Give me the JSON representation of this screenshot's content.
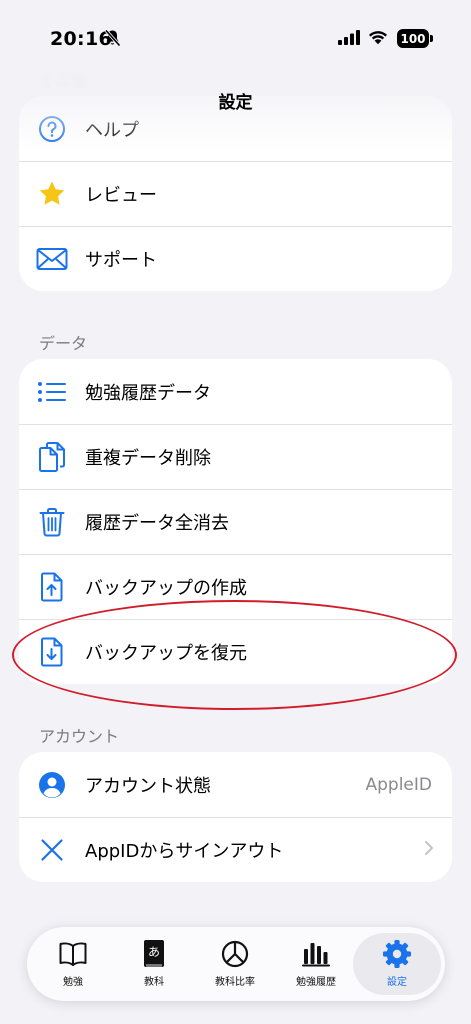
{
  "status_bar": {
    "time": "20:16",
    "battery": "100"
  },
  "nav": {
    "title": "設定",
    "ghost_header": "その他"
  },
  "sections": {
    "other": {
      "items": [
        {
          "label": "ヘルプ",
          "icon": "question-circle-icon"
        },
        {
          "label": "レビュー",
          "icon": "star-icon"
        },
        {
          "label": "サポート",
          "icon": "envelope-icon"
        }
      ]
    },
    "data": {
      "title": "データ",
      "items": [
        {
          "label": "勉強履歴データ",
          "icon": "list-icon"
        },
        {
          "label": "重複データ削除",
          "icon": "duplicate-doc-icon"
        },
        {
          "label": "履歴データ全消去",
          "icon": "trash-icon"
        },
        {
          "label": "バックアップの作成",
          "icon": "doc-upload-icon"
        },
        {
          "label": "バックアップを復元",
          "icon": "doc-download-icon"
        }
      ]
    },
    "account": {
      "title": "アカウント",
      "items": [
        {
          "label": "アカウント状態",
          "value": "AppleID",
          "icon": "person-circle-icon"
        },
        {
          "label": "AppIDからサインアウト",
          "icon": "x-mark-icon"
        }
      ]
    }
  },
  "tabs": [
    {
      "label": "勉強",
      "icon": "book-icon"
    },
    {
      "label": "教科",
      "icon": "notebook-icon"
    },
    {
      "label": "教科比率",
      "icon": "pie-chart-icon"
    },
    {
      "label": "勉強履歴",
      "icon": "bar-chart-icon"
    },
    {
      "label": "設定",
      "icon": "gear-icon",
      "active": true
    }
  ],
  "colors": {
    "accent": "#1a73e8",
    "star": "#f5c518",
    "annotation": "#d11d2a"
  }
}
